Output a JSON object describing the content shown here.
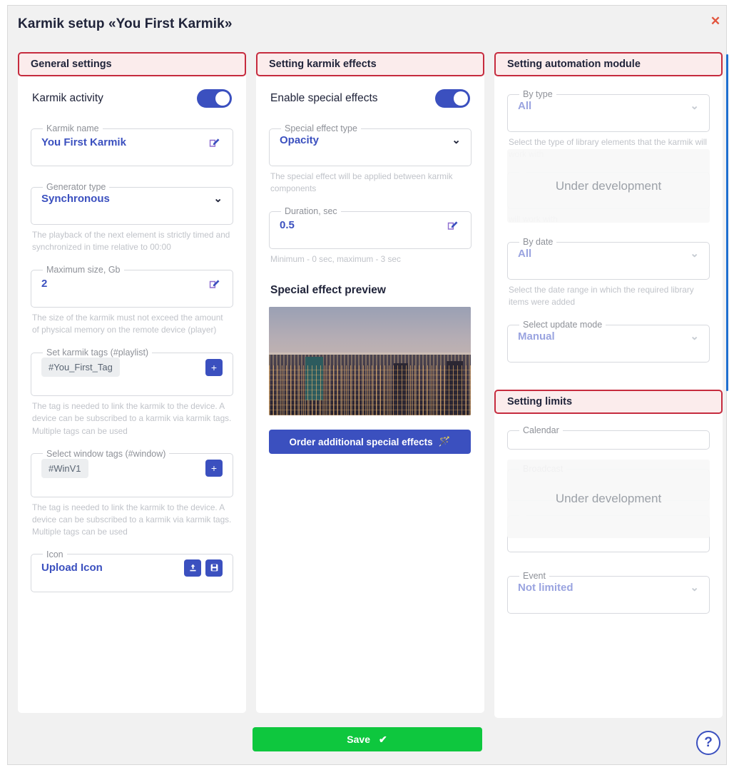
{
  "window": {
    "title": "Karmik setup «You First Karmik»",
    "close_icon": "close-icon",
    "close_glyph": "✕"
  },
  "colors": {
    "accent_blue": "#3b50bf",
    "panel_border_red": "#c62b3e",
    "panel_fill_pink": "#fbecec",
    "save_green": "#0ec73e",
    "close_red": "#e2543d",
    "scrollbar_blue": "#1f6fd0"
  },
  "general": {
    "header": "General settings",
    "activity": {
      "label": "Karmik activity",
      "enabled": true
    },
    "name": {
      "legend": "Karmik name",
      "value": "You First Karmik",
      "edit_icon": "edit-icon"
    },
    "generator": {
      "legend": "Generator type",
      "value": "Synchronous",
      "chevron": "chevron-down-icon",
      "hint": "The playback of the next element is strictly timed and synchronized in time relative to 00:00"
    },
    "max_size": {
      "legend": "Maximum size, Gb",
      "value": "2",
      "edit_icon": "edit-icon",
      "hint": "The size of the karmik must not exceed the amount of physical memory on the remote device (player)"
    },
    "karmik_tags": {
      "legend": "Set karmik tags (#playlist)",
      "tags": [
        "#You_First_Tag"
      ],
      "add_label": "+",
      "hint": "The tag is needed to link the karmik to the device. A device can be subscribed to a karmik via karmik tags. Multiple tags can be used"
    },
    "window_tags": {
      "legend": "Select window tags (#window)",
      "tags": [
        "#WinV1"
      ],
      "add_label": "+",
      "hint": "The tag is needed to link the karmik to the device. A device can be subscribed to a karmik via karmik tags. Multiple tags can be used"
    },
    "icon": {
      "legend": "Icon",
      "value": "Upload Icon",
      "upload_icon": "upload-icon",
      "save_icon": "save-disk-icon"
    }
  },
  "effects": {
    "header": "Setting karmik effects",
    "enable": {
      "label": "Enable special effects",
      "enabled": true
    },
    "effect_type": {
      "legend": "Special effect type",
      "value": "Opacity",
      "chevron": "chevron-down-icon",
      "hint": "The special effect will be applied between karmik components"
    },
    "duration": {
      "legend": "Duration, sec",
      "value": "0.5",
      "edit_icon": "edit-icon",
      "hint": "Minimum - 0 sec, maximum - 3 sec"
    },
    "preview": {
      "title": "Special effect preview",
      "image_alt": "city-skyline-at-dusk"
    },
    "order_button": {
      "label": "Order additional special effects",
      "icon": "magic-wand-icon",
      "glyph": "🪄"
    }
  },
  "automation": {
    "header": "Setting automation module",
    "overlay_text": "Under development",
    "by_type": {
      "legend": "By type",
      "value": "All",
      "chevron": "chevron-down-icon",
      "hint": "Select the type of library elements that the karmik will work with"
    },
    "clipped_hint": "will work with",
    "by_date": {
      "legend": "By date",
      "value": "All",
      "chevron": "chevron-down-icon",
      "hint": "Select the date range in which the required library items were added"
    },
    "update_mode": {
      "legend": "Select update mode",
      "value": "Manual",
      "chevron": "chevron-down-icon"
    }
  },
  "limits": {
    "header": "Setting limits",
    "overlay_text": "Under development",
    "calendar": {
      "legend": "Calendar",
      "value": ""
    },
    "broadcast": {
      "legend": "Broadcast",
      "value": ""
    },
    "event": {
      "legend": "Event",
      "value": "Not limited",
      "chevron": "chevron-down-icon"
    }
  },
  "footer": {
    "save_label": "Save",
    "save_glyph": "✔",
    "help_glyph": "?"
  }
}
